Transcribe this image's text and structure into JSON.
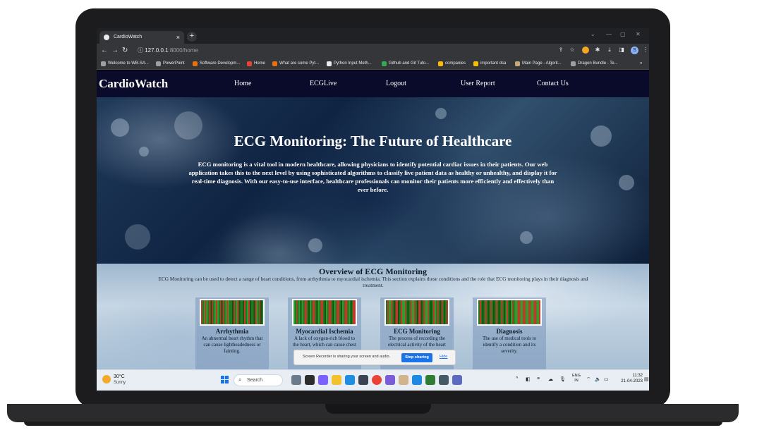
{
  "browser": {
    "tab_title": "CardioWatch",
    "tab_close": "×",
    "new_tab": "+",
    "url_host": "127.0.0.1",
    "url_rest": ":8000/home",
    "profile_initial": "S",
    "bookmarks": [
      {
        "label": "Welcome to WB-SA...",
        "color": "#9aa0a6"
      },
      {
        "label": "PowerPoint",
        "color": "#9aa0a6"
      },
      {
        "label": "Software Developm...",
        "color": "#e8710a"
      },
      {
        "label": "Home",
        "color": "#ea4335"
      },
      {
        "label": "What are some Pyt...",
        "color": "#e8710a"
      },
      {
        "label": "Python Input Meth...",
        "color": "#e8eaed"
      },
      {
        "label": "Github and Git Tuto...",
        "color": "#34a853"
      },
      {
        "label": "companies",
        "color": "#fbbc04"
      },
      {
        "label": "important dsa",
        "color": "#fbbc04"
      },
      {
        "label": "Main Page - Algorit...",
        "color": "#c5a97a"
      },
      {
        "label": "Dragon Bundle - Te...",
        "color": "#9aa0a6"
      }
    ],
    "bookmarks_more": "»"
  },
  "site": {
    "brand": "CardioWatch",
    "nav": [
      "Home",
      "ECGLive",
      "Logout",
      "User Report",
      "Contact Us"
    ],
    "hero_title": "ECG Monitoring: The Future of Healthcare",
    "hero_text": "ECG monitoring is a vital tool in modern healthcare, allowing physicians to identify potential cardiac issues in their patients. Our web application takes this to the next level by using sophisticated algorithms to classify live patient data as healthy or unhealthy, and display it for real-time diagnosis. With our easy-to-use interface, healthcare professionals can monitor their patients more efficiently and effectively than ever before.",
    "overview_title": "Overview of ECG Monitoring",
    "overview_text": "ECG Monitoring can be used to detect a range of heart conditions, from arrhythmia to myocardial ischemia. This section explains these conditions and the role that ECG monitoring plays in their diagnosis and treatment.",
    "cards": [
      {
        "title": "Arrhythmia",
        "desc": "An abnormal heart rhythm that can cause lightheadedness or fainting."
      },
      {
        "title": "Myocardial Ischemia",
        "desc": "A lack of oxygen-rich blood to the heart, which can cause chest"
      },
      {
        "title": "ECG Monitoring",
        "desc": "The process of recording the electrical activity of the heart"
      },
      {
        "title": "Diagnosis",
        "desc": "The use of medical tools to identify a condition and its severity."
      }
    ]
  },
  "screen_share": {
    "message": "Screen Recorder is sharing your screen and audio.",
    "stop_label": "Stop sharing",
    "hide_label": "Hide"
  },
  "taskbar": {
    "temperature": "30°C",
    "condition": "Sunny",
    "search_label": "Search",
    "lang_top": "ENG",
    "lang_bottom": "IN",
    "time": "11:32",
    "date": "21-04-2023"
  }
}
